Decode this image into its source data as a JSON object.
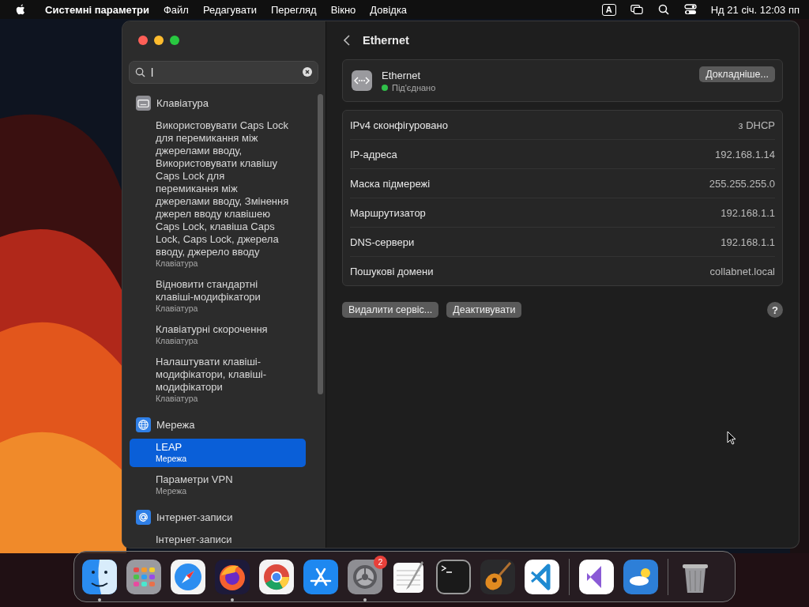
{
  "menu_bar": {
    "app": "Системні параметри",
    "menus": [
      "Файл",
      "Редагувати",
      "Перегляд",
      "Вікно",
      "Довідка"
    ],
    "input_source": "A",
    "clock": "Нд 21 січ.  12:03 пп"
  },
  "sidebar": {
    "search": {
      "value": "l"
    },
    "groups": [
      {
        "title": "Клавіатура",
        "kind": "keyboard",
        "items": [
          {
            "title": "Використовувати Caps Lock для перемикання між джерелами вводу, Використовувати клавішу Caps Lock для перемикання між джерелами вводу, Змінення джерел вводу клавішею Caps Lock, клавіша Caps Lock, Caps Lock, джерела вводу, джерело вводу",
            "subtitle": "Клавіатура",
            "selected": false
          },
          {
            "title": "Відновити стандартні клавіші-модифікатори",
            "subtitle": "Клавіатура",
            "selected": false
          },
          {
            "title": "Клавіатурні скорочення",
            "subtitle": "Клавіатура",
            "selected": false
          },
          {
            "title": "Налаштувати клавіші-модифікатори, клавіші-модифікатори",
            "subtitle": "Клавіатура",
            "selected": false
          }
        ]
      },
      {
        "title": "Мережа",
        "kind": "globe",
        "items": [
          {
            "title": "LEAP",
            "subtitle": "Мережа",
            "selected": true
          },
          {
            "title": "Параметри VPN",
            "subtitle": "Мережа",
            "selected": false
          }
        ]
      },
      {
        "title": "Інтернет-записи",
        "kind": "at",
        "items": [
          {
            "title": "Інтернет-записи",
            "selected": false
          }
        ]
      }
    ]
  },
  "detail": {
    "title": "Ethernet",
    "service": {
      "name": "Ethernet",
      "status": "Під'єднано",
      "details_button": "Докладніше..."
    },
    "rows": [
      {
        "label": "IPv4 сконфігуровано",
        "value": "з DHCP"
      },
      {
        "label": "IP-адреса",
        "value": "192.168.1.14"
      },
      {
        "label": "Маска підмережі",
        "value": "255.255.255.0"
      },
      {
        "label": "Маршрутизатор",
        "value": "192.168.1.1"
      },
      {
        "label": "DNS-сервери",
        "value": "192.168.1.1"
      },
      {
        "label": "Пошукові домени",
        "value": "collabnet.local"
      }
    ],
    "buttons": [
      "Видалити сервіс...",
      "Деактивувати"
    ],
    "help": "?"
  },
  "dock": [
    {
      "kind": "finder",
      "running": true
    },
    {
      "kind": "launchpad",
      "running": false
    },
    {
      "kind": "safari",
      "running": false
    },
    {
      "kind": "firefox",
      "running": true
    },
    {
      "kind": "chrome",
      "running": false
    },
    {
      "kind": "appstore",
      "running": false
    },
    {
      "kind": "settings",
      "running": true,
      "badge": "2"
    },
    {
      "kind": "textedit",
      "running": false
    },
    {
      "kind": "terminal",
      "running": false
    },
    {
      "kind": "guitar",
      "running": false
    },
    {
      "kind": "vscode",
      "running": false
    },
    {
      "kind": "separator"
    },
    {
      "kind": "vstudio",
      "running": false
    },
    {
      "kind": "weather",
      "running": false
    },
    {
      "kind": "separator"
    },
    {
      "kind": "trash",
      "running": false
    }
  ]
}
